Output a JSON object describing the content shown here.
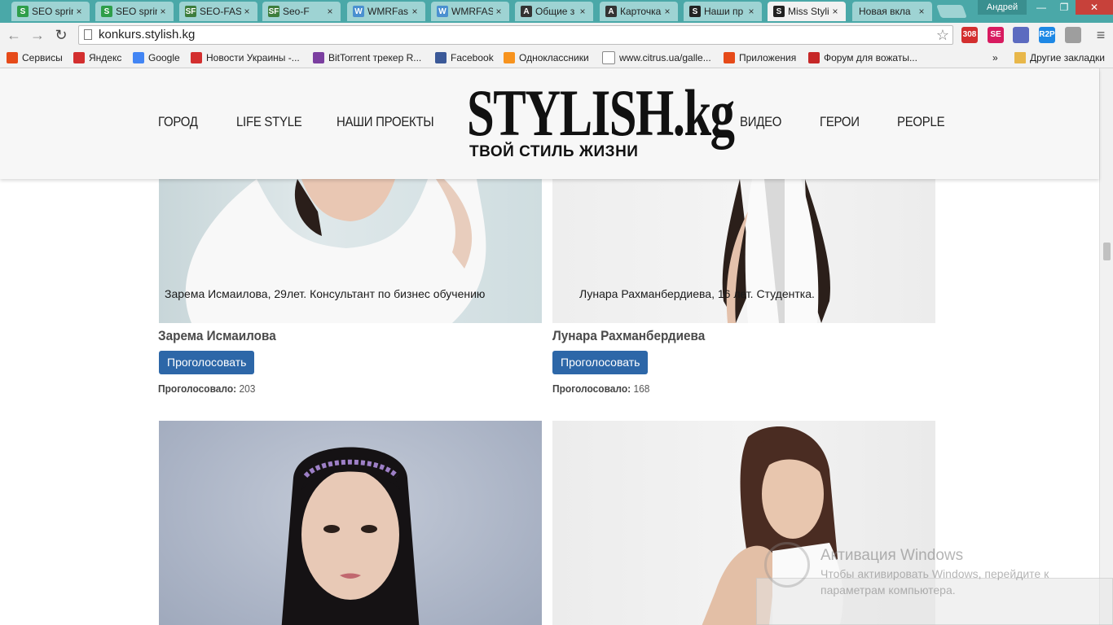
{
  "browser": {
    "tabs": [
      {
        "label": "SEO sprin",
        "icon": "seosprint-icon",
        "color": "#2e9e4a",
        "glyph": "S"
      },
      {
        "label": "SEO sprin",
        "icon": "seosprint-icon",
        "color": "#2e9e4a",
        "glyph": "S"
      },
      {
        "label": "SEO-FAS",
        "icon": "seofast-icon",
        "color": "#3d7d3d",
        "glyph": "SF"
      },
      {
        "label": "Seo-F",
        "icon": "seofast-icon",
        "color": "#3d7d3d",
        "glyph": "SF"
      },
      {
        "label": "WMRFas",
        "icon": "wmrfast-icon",
        "color": "#4a90d0",
        "glyph": "W"
      },
      {
        "label": "WMRFAS",
        "icon": "wmrfast-icon",
        "color": "#4a90d0",
        "glyph": "W"
      },
      {
        "label": "Общие з",
        "icon": "a-icon",
        "color": "#333333",
        "glyph": "A"
      },
      {
        "label": "Карточка",
        "icon": "a-icon",
        "color": "#333333",
        "glyph": "A"
      },
      {
        "label": "Наши пр",
        "icon": "stylish-icon",
        "color": "#222222",
        "glyph": "S"
      },
      {
        "label": "Miss Styli",
        "icon": "stylish-icon",
        "color": "#222222",
        "glyph": "S"
      },
      {
        "label": "Новая вкла",
        "icon": "",
        "color": "",
        "glyph": ""
      }
    ],
    "active_tab": 9,
    "profile_name": "Андрей",
    "url": "konkurs.stylish.kg",
    "bookmarks": [
      {
        "label": "Сервисы",
        "icon": "apps-grid-icon",
        "color": "#e64a19"
      },
      {
        "label": "Яндекс",
        "icon": "yandex-icon",
        "color": "#d32f2f"
      },
      {
        "label": "Google",
        "icon": "google-icon",
        "color": "#4285f4"
      },
      {
        "label": "Новости Украины -...",
        "icon": "news-icon",
        "color": "#d32f2f"
      },
      {
        "label": "BitTorrent трекер R...",
        "icon": "torrent-icon",
        "color": "#7b3fa0"
      },
      {
        "label": "Facebook",
        "icon": "facebook-icon",
        "color": "#3b5998"
      },
      {
        "label": "Одноклассники",
        "icon": "odnoklassniki-icon",
        "color": "#f7931e"
      },
      {
        "label": "www.citrus.ua/galle...",
        "icon": "page-icon",
        "color": "#ffffff"
      },
      {
        "label": "Приложения",
        "icon": "apps-grid-icon",
        "color": "#e64a19"
      },
      {
        "label": "Форум для вожаты...",
        "icon": "forum-icon",
        "color": "#c62828"
      }
    ],
    "bookmarks_overflow": "»",
    "other_bookmarks": "Другие закладки",
    "extensions": [
      {
        "name": "mail-badge-icon",
        "text": "308",
        "color": "#d32f2f"
      },
      {
        "name": "seo-ext-icon",
        "text": "SE",
        "color": "#d81b60"
      },
      {
        "name": "notes-ext-icon",
        "text": "",
        "color": "#5c6bc0"
      },
      {
        "name": "r2p-ext-icon",
        "text": "R2P",
        "color": "#1e88e5"
      },
      {
        "name": "shield-ext-icon",
        "text": "",
        "color": "#9e9e9e"
      }
    ]
  },
  "site": {
    "logo_title": "STYLISH.kg",
    "logo_subtitle": "ТВОЙ СТИЛЬ ЖИЗНИ",
    "nav_left": [
      "ГОРОД",
      "LIFE STYLE",
      "НАШИ ПРОЕКТЫ"
    ],
    "nav_right": [
      "ВИДЕО",
      "ГЕРОИ",
      "PEOPLE"
    ]
  },
  "contestants": [
    {
      "caption": "Зарема Исмаилова, 29лет. Консультант по бизнес обучению",
      "name": "Зарема Исмаилова",
      "button_label": "Проголосовать",
      "votes_label": "Проголосовало:",
      "votes": "203"
    },
    {
      "caption": "Лунара Рахманбердиева, 16 лет. Студентка.",
      "name": "Лунара Рахманбердиева",
      "button_label": "Проголосовать",
      "votes_label": "Проголосовало:",
      "votes": "168"
    },
    {
      "caption": "",
      "name": "",
      "button_label": "",
      "votes_label": "",
      "votes": ""
    },
    {
      "caption": "",
      "name": "",
      "button_label": "",
      "votes_label": "",
      "votes": ""
    }
  ],
  "windows_activation": {
    "title": "Активация Windows",
    "text": "Чтобы активировать Windows, перейдите к параметрам компьютера."
  },
  "colors": {
    "tabstrip": "#4aa8a8",
    "vote_button": "#2d67a8",
    "header_bg": "#f7f7f7"
  }
}
